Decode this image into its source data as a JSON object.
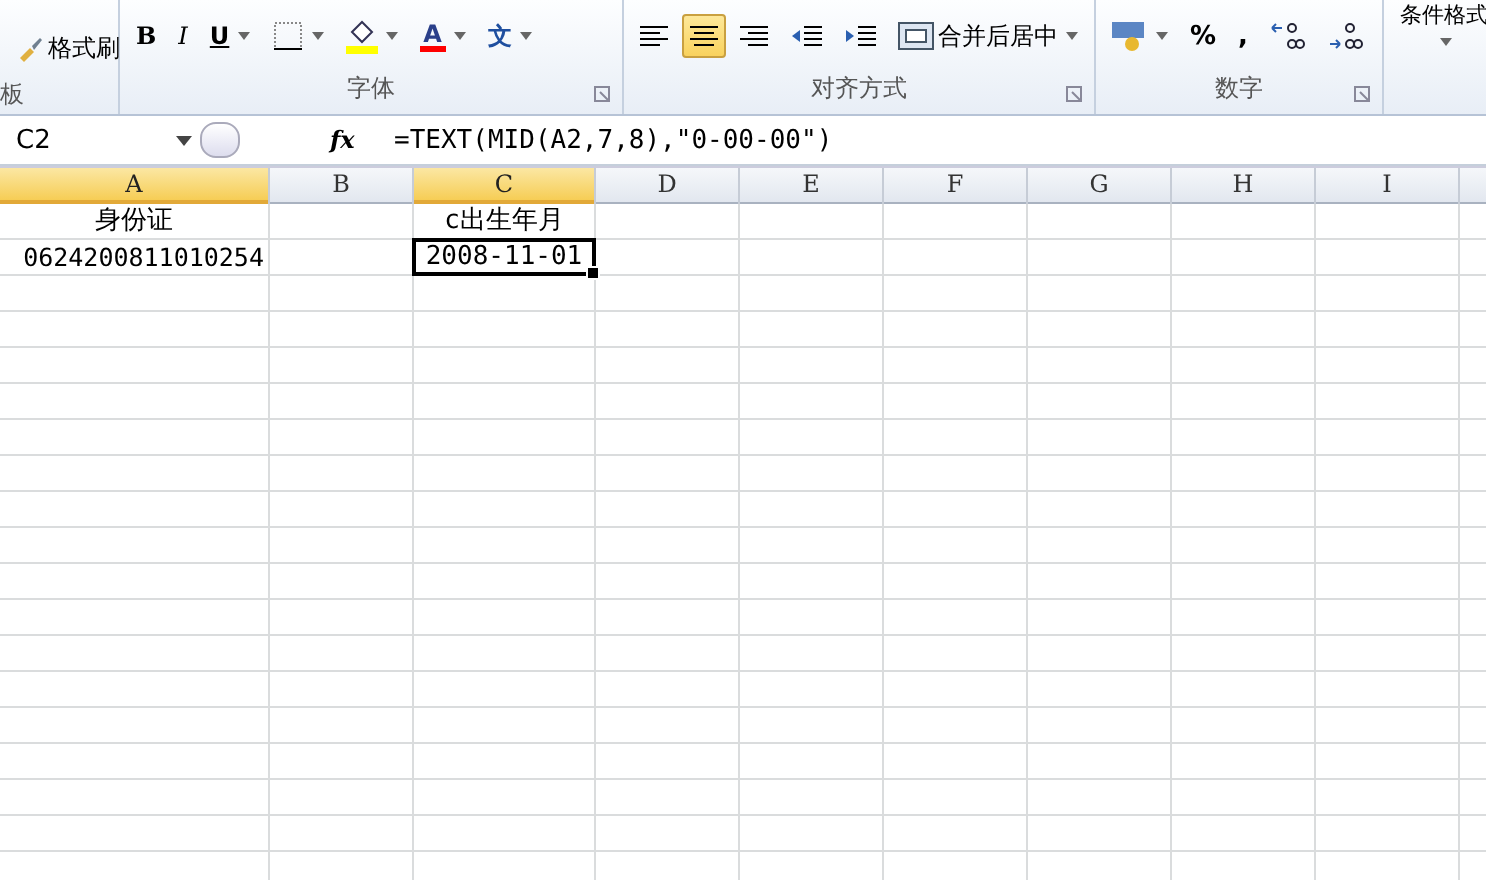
{
  "ribbon": {
    "groups": [
      {
        "label": "板",
        "buttons": [
          {
            "kind": "brush",
            "label": "格式刷"
          }
        ]
      },
      {
        "label": "字体",
        "buttons": [
          {
            "kind": "bold",
            "label": "B"
          },
          {
            "kind": "italic",
            "label": "I"
          },
          {
            "kind": "underline",
            "label": "U",
            "dropdown": true
          },
          {
            "kind": "border",
            "dropdown": true
          },
          {
            "kind": "fill",
            "dropdown": true
          },
          {
            "kind": "fontcolor",
            "label": "A",
            "dropdown": true
          },
          {
            "kind": "phonetic",
            "label": "文",
            "dropdown": true
          }
        ]
      },
      {
        "label": "对齐方式",
        "buttons": [
          {
            "kind": "align-left",
            "selected": false
          },
          {
            "kind": "align-center",
            "selected": true
          },
          {
            "kind": "align-right",
            "selected": false
          },
          {
            "kind": "outdent"
          },
          {
            "kind": "indent"
          },
          {
            "kind": "merge",
            "label": "合并后居中",
            "dropdown": true
          }
        ]
      },
      {
        "label": "数字",
        "buttons": [
          {
            "kind": "currency",
            "dropdown": true
          },
          {
            "kind": "text",
            "label": "%"
          },
          {
            "kind": "text",
            "label": ","
          },
          {
            "kind": "inc-decimal"
          },
          {
            "kind": "dec-decimal"
          }
        ]
      },
      {
        "buttons": [
          {
            "kind": "styles",
            "label": "条件格式",
            "dropdown": true
          }
        ]
      }
    ]
  },
  "name_box": "C2",
  "fx": "fx",
  "formula": "=TEXT(MID(A2,7,8),\"0-00-00\")",
  "columns": [
    {
      "label": "A",
      "selected": true,
      "cells": [
        {
          "text": "身份证",
          "kind": "text",
          "selected": false
        },
        {
          "text": "0624200811010254",
          "kind": "number",
          "selected": false
        }
      ]
    },
    {
      "label": "B",
      "selected": false
    },
    {
      "label": "C",
      "selected": true,
      "cells": [
        {
          "text": "c出生年月",
          "kind": "text",
          "selected": false
        },
        {
          "text": "2008-11-01",
          "kind": "date",
          "selected": true
        }
      ]
    },
    {
      "label": "D",
      "selected": false
    },
    {
      "label": "E",
      "selected": false
    },
    {
      "label": "F",
      "selected": false
    },
    {
      "label": "G",
      "selected": false
    },
    {
      "label": "H",
      "selected": false
    },
    {
      "label": "I",
      "selected": false
    }
  ]
}
